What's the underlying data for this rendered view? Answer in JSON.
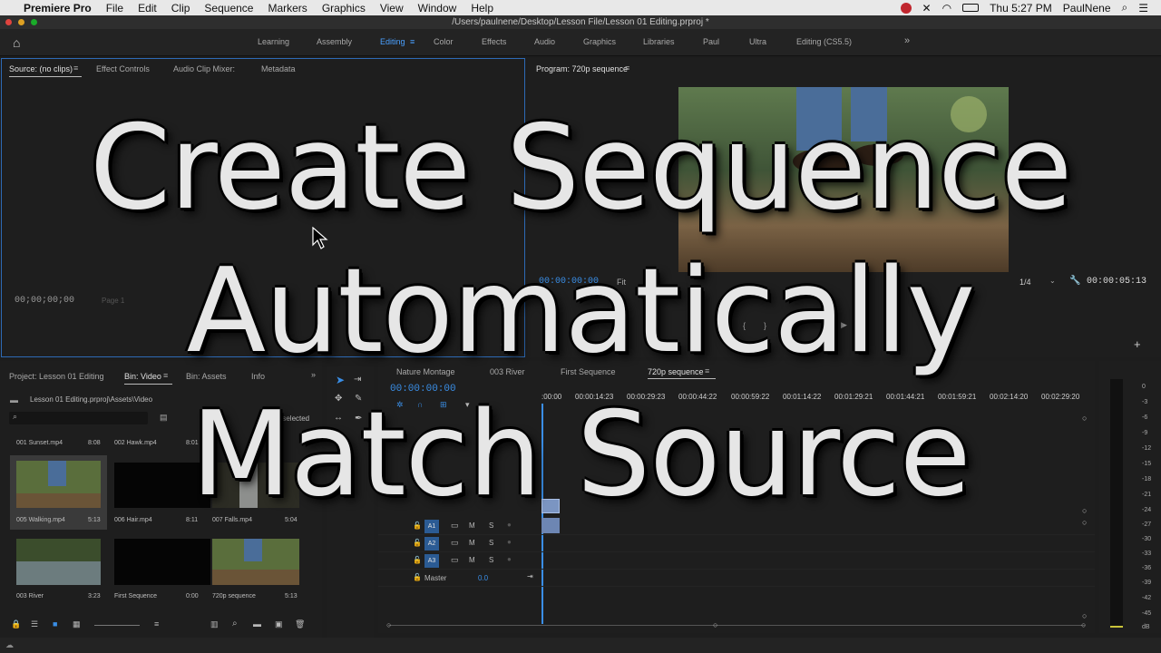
{
  "menubar": {
    "app_name": "Premiere Pro",
    "items": [
      "File",
      "Edit",
      "Clip",
      "Sequence",
      "Markers",
      "Graphics",
      "View",
      "Window",
      "Help"
    ],
    "clock": "Thu 5:27 PM",
    "user": "PaulNene"
  },
  "window": {
    "title": "/Users/paulnene/Desktop/Lesson File/Lesson 01 Editing.prproj *"
  },
  "workspaces": {
    "items": [
      "Learning",
      "Assembly",
      "Editing",
      "Color",
      "Effects",
      "Audio",
      "Graphics",
      "Libraries",
      "Paul",
      "Ultra",
      "Editing (CS5.5)"
    ],
    "active": "Editing"
  },
  "source_panel": {
    "tabs": [
      "Source: (no clips)",
      "Effect Controls",
      "Audio Clip Mixer:",
      "Metadata"
    ],
    "timecode": "00;00;00;00",
    "page": "Page 1"
  },
  "program_panel": {
    "title": "Program: 720p sequence",
    "timecode": "00:00:00:00",
    "fit": "Fit",
    "resolution": "1/4",
    "duration": "00:00:05:13"
  },
  "project_panel": {
    "tabs": [
      "Project: Lesson 01 Editing",
      "Bin: Video",
      "Bin: Assets",
      "Info"
    ],
    "path": "Lesson 01 Editing.prproj\\Assets\\Video",
    "selection": "items selected",
    "clips": [
      {
        "name": "001 Sunset.mp4",
        "duration": "8:08"
      },
      {
        "name": "002 Hawk.mp4",
        "duration": "8:01"
      },
      {
        "name": "005 Walking.mp4",
        "duration": "5:13"
      },
      {
        "name": "006 Hair.mp4",
        "duration": "8:11"
      },
      {
        "name": "007 Falls.mp4",
        "duration": "5:04"
      },
      {
        "name": "003 River",
        "duration": "3:23"
      },
      {
        "name": "First Sequence",
        "duration": "0:00"
      },
      {
        "name": "720p sequence",
        "duration": "5:13"
      }
    ]
  },
  "timeline": {
    "tabs": [
      "Nature Montage",
      "003 River",
      "First Sequence",
      "720p sequence"
    ],
    "timecode": "00:00:00:00",
    "ruler": [
      ":00:00",
      "00:00:14:23",
      "00:00:29:23",
      "00:00:44:22",
      "00:00:59:22",
      "00:01:14:22",
      "00:01:29:21",
      "00:01:44:21",
      "00:01:59:21",
      "00:02:14:20",
      "00:02:29:20"
    ],
    "audio_tracks": [
      "A1",
      "A2",
      "A3"
    ],
    "mute": "M",
    "solo": "S",
    "master_label": "Master",
    "master_value": "0.0"
  },
  "meter": {
    "ticks": [
      "0",
      "-3",
      "-6",
      "-9",
      "-12",
      "-15",
      "-18",
      "-21",
      "-24",
      "-27",
      "-30",
      "-33",
      "-36",
      "-39",
      "-42",
      "-45",
      "dB"
    ]
  },
  "overlay": {
    "line1": "Create Sequence",
    "line2": "Automatically",
    "line3": "Match Source"
  },
  "colors": {
    "accent": "#3a8ee6",
    "panel": "#1e1e1e",
    "clip_audio": "#6d86b3"
  }
}
